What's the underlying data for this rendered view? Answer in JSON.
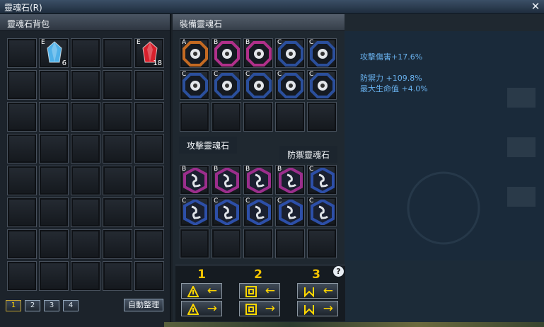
{
  "window": {
    "title": "靈魂石(R)",
    "close_icon": "close-icon"
  },
  "left": {
    "title": "靈魂石背包",
    "items": [
      {
        "slot": 1,
        "grade": "E",
        "color": "#4fb0e8",
        "qty": "6",
        "icon": "blue-crystal-icon"
      },
      {
        "slot": 4,
        "grade": "E",
        "color": "#d8202c",
        "qty": "18",
        "icon": "red-crystal-icon"
      }
    ],
    "pages": [
      "1",
      "2",
      "3",
      "4"
    ],
    "active_page": "1",
    "sort_label": "自動整理"
  },
  "right": {
    "equip_tab": "裝備靈魂石",
    "attack_label": "攻擊靈魂石",
    "defense_label": "防禦靈魂石",
    "equipped_top": [
      {
        "grade": "A",
        "ring": "#c46a22"
      },
      {
        "grade": "B",
        "ring": "#b0308a"
      },
      {
        "grade": "B",
        "ring": "#b0308a"
      },
      {
        "grade": "C",
        "ring": "#2b4f9c"
      },
      {
        "grade": "C",
        "ring": "#2b4f9c"
      },
      {
        "grade": "C",
        "ring": "#2b4f9c"
      },
      {
        "grade": "C",
        "ring": "#2b4f9c"
      },
      {
        "grade": "C",
        "ring": "#2b4f9c"
      },
      {
        "grade": "C",
        "ring": "#2b4f9c"
      },
      {
        "grade": "C",
        "ring": "#2b4f9c"
      }
    ],
    "equipped_bottom": [
      {
        "grade": "B",
        "ring": "#9b2e8c"
      },
      {
        "grade": "B",
        "ring": "#9b2e8c"
      },
      {
        "grade": "B",
        "ring": "#9b2e8c"
      },
      {
        "grade": "B",
        "ring": "#9b2e8c"
      },
      {
        "grade": "C",
        "ring": "#2d4fa8"
      },
      {
        "grade": "C",
        "ring": "#2d4fa8"
      },
      {
        "grade": "C",
        "ring": "#2d4fa8"
      },
      {
        "grade": "C",
        "ring": "#2d4fa8"
      },
      {
        "grade": "C",
        "ring": "#2d4fa8"
      },
      {
        "grade": "C",
        "ring": "#2d4fa8"
      }
    ]
  },
  "stats": {
    "line1": "攻擊傷害+17.6%",
    "line2": "防禦力 +109.8%",
    "line3": "最大生命值 +4.0%"
  },
  "presets": [
    {
      "num": "1",
      "symbol": "triangle-rune-icon"
    },
    {
      "num": "2",
      "symbol": "spiral-rune-icon"
    },
    {
      "num": "3",
      "symbol": "bowtie-rune-icon"
    }
  ],
  "help_label": "?"
}
